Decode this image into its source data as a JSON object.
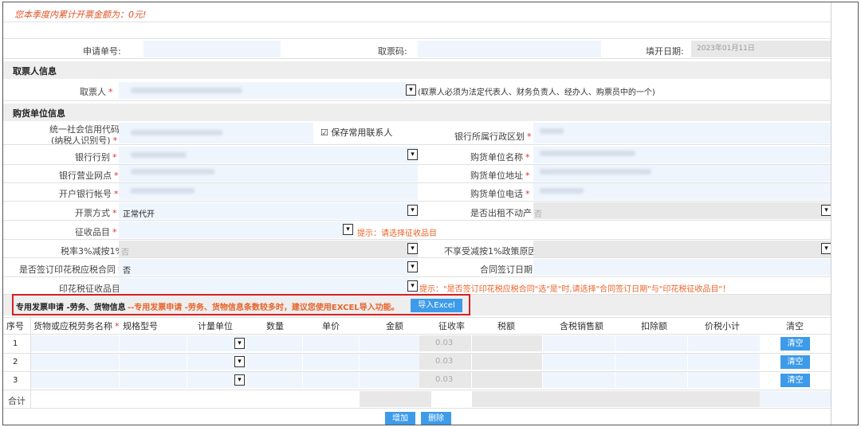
{
  "notice": "您本季度内累计开票金额为：0元!",
  "header": {
    "apply_no_label": "申请单号:",
    "pickup_code_label": "取票码:",
    "fill_date_label": "填开日期:",
    "fill_date_value": "2023年01月11日"
  },
  "sections": {
    "receiver": "取票人信息",
    "buyer": "购货单位信息"
  },
  "receiver": {
    "label": "取票人",
    "required": "*",
    "note": "(取票人必须为法定代表人、财务负责人、经办人、购票员中的一个)"
  },
  "buyer": {
    "credit_code_label_1": "统一社会信用代码",
    "credit_code_label_2": "(纳税人识别号)",
    "save_contact": "保存常用联系人",
    "bank_region_label": "银行所属行政区划",
    "bank_type_label": "银行行别",
    "buyer_name_label": "购货单位名称",
    "bank_branch_label": "银行营业网点",
    "buyer_address_label": "购货单位地址",
    "account_label": "开户银行帐号",
    "buyer_phone_label": "购货单位电话",
    "invoice_method_label": "开票方式",
    "invoice_method_value": "正常代开",
    "rent_label": "是否出租不动产",
    "rent_value": "否",
    "tax_item_label": "征收品目",
    "tax_item_hint": "提示：请选择征收品目",
    "rate_label": "税率3%减按1%",
    "rate_value": "否",
    "no_reduction_label": "不享受减按1%政策原因",
    "stamp_contract_label": "是否签订印花税应税合同",
    "stamp_contract_value": "否",
    "contract_date_label": "合同签订日期",
    "stamp_item_label": "印花税征收品目",
    "stamp_hint": "提示：\"是否签订印花税应税合同\"选\"是\"时,请选择\"合同签订日期\"与\"印花税征收品目\"！"
  },
  "special": {
    "title": "专用发票申请 -劳务、货物信息",
    "hint": "--专用发票申请 -劳务、货物信息条数较多时，建议您使用EXCEL导入功能。",
    "import_button": "导入Excel"
  },
  "table": {
    "headers": [
      "序号",
      "货物或应税劳务名称",
      "规格型号",
      "计量单位",
      "数量",
      "单价",
      "金额",
      "征收率",
      "税额",
      "含税销售额",
      "扣除额",
      "价税小计",
      "清空"
    ],
    "rows": [
      {
        "no": "1",
        "rate": "0.03",
        "clear": "清空"
      },
      {
        "no": "2",
        "rate": "0.03",
        "clear": "清空"
      },
      {
        "no": "3",
        "rate": "0.03",
        "clear": "清空"
      }
    ],
    "total_label": "合计"
  },
  "footer": {
    "add_button": "增加",
    "delete_button": "删除"
  },
  "icons": {
    "dropdown": "chevron-down-icon",
    "checkbox": "checkbox-checked-icon"
  },
  "colors": {
    "input_bg": "#eef5fd",
    "accent_button": "#3d9be9",
    "hint_orange": "#e8632a",
    "highlight_red": "#d62020"
  }
}
